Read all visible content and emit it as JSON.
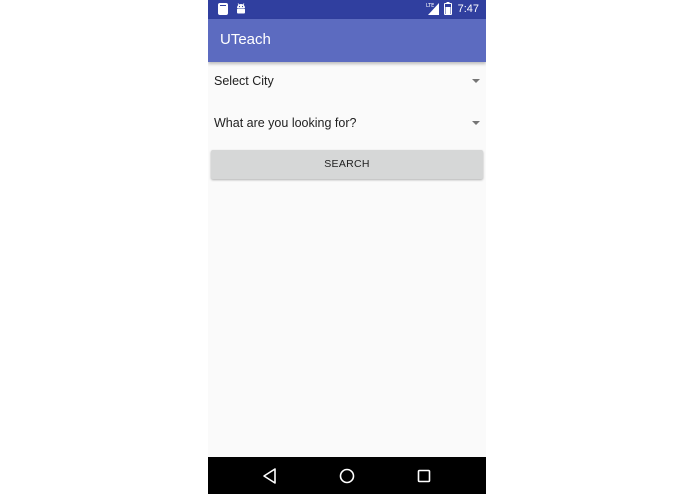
{
  "status_bar": {
    "time": "7:47",
    "left_icons": [
      "notification-app-icon",
      "android-icon"
    ],
    "right_icons": [
      "lte-signal-icon",
      "battery-icon"
    ],
    "background_color": "#303f9f"
  },
  "app_bar": {
    "title": "UTeach",
    "background_color": "#5c6bc0"
  },
  "form": {
    "city_spinner": {
      "selected": "Select City"
    },
    "looking_spinner": {
      "selected": "What are you looking for?"
    },
    "search_button_label": "SEARCH"
  },
  "nav_bar": {
    "icons": [
      "back-icon",
      "home-icon",
      "recents-icon"
    ],
    "background_color": "#000000"
  }
}
